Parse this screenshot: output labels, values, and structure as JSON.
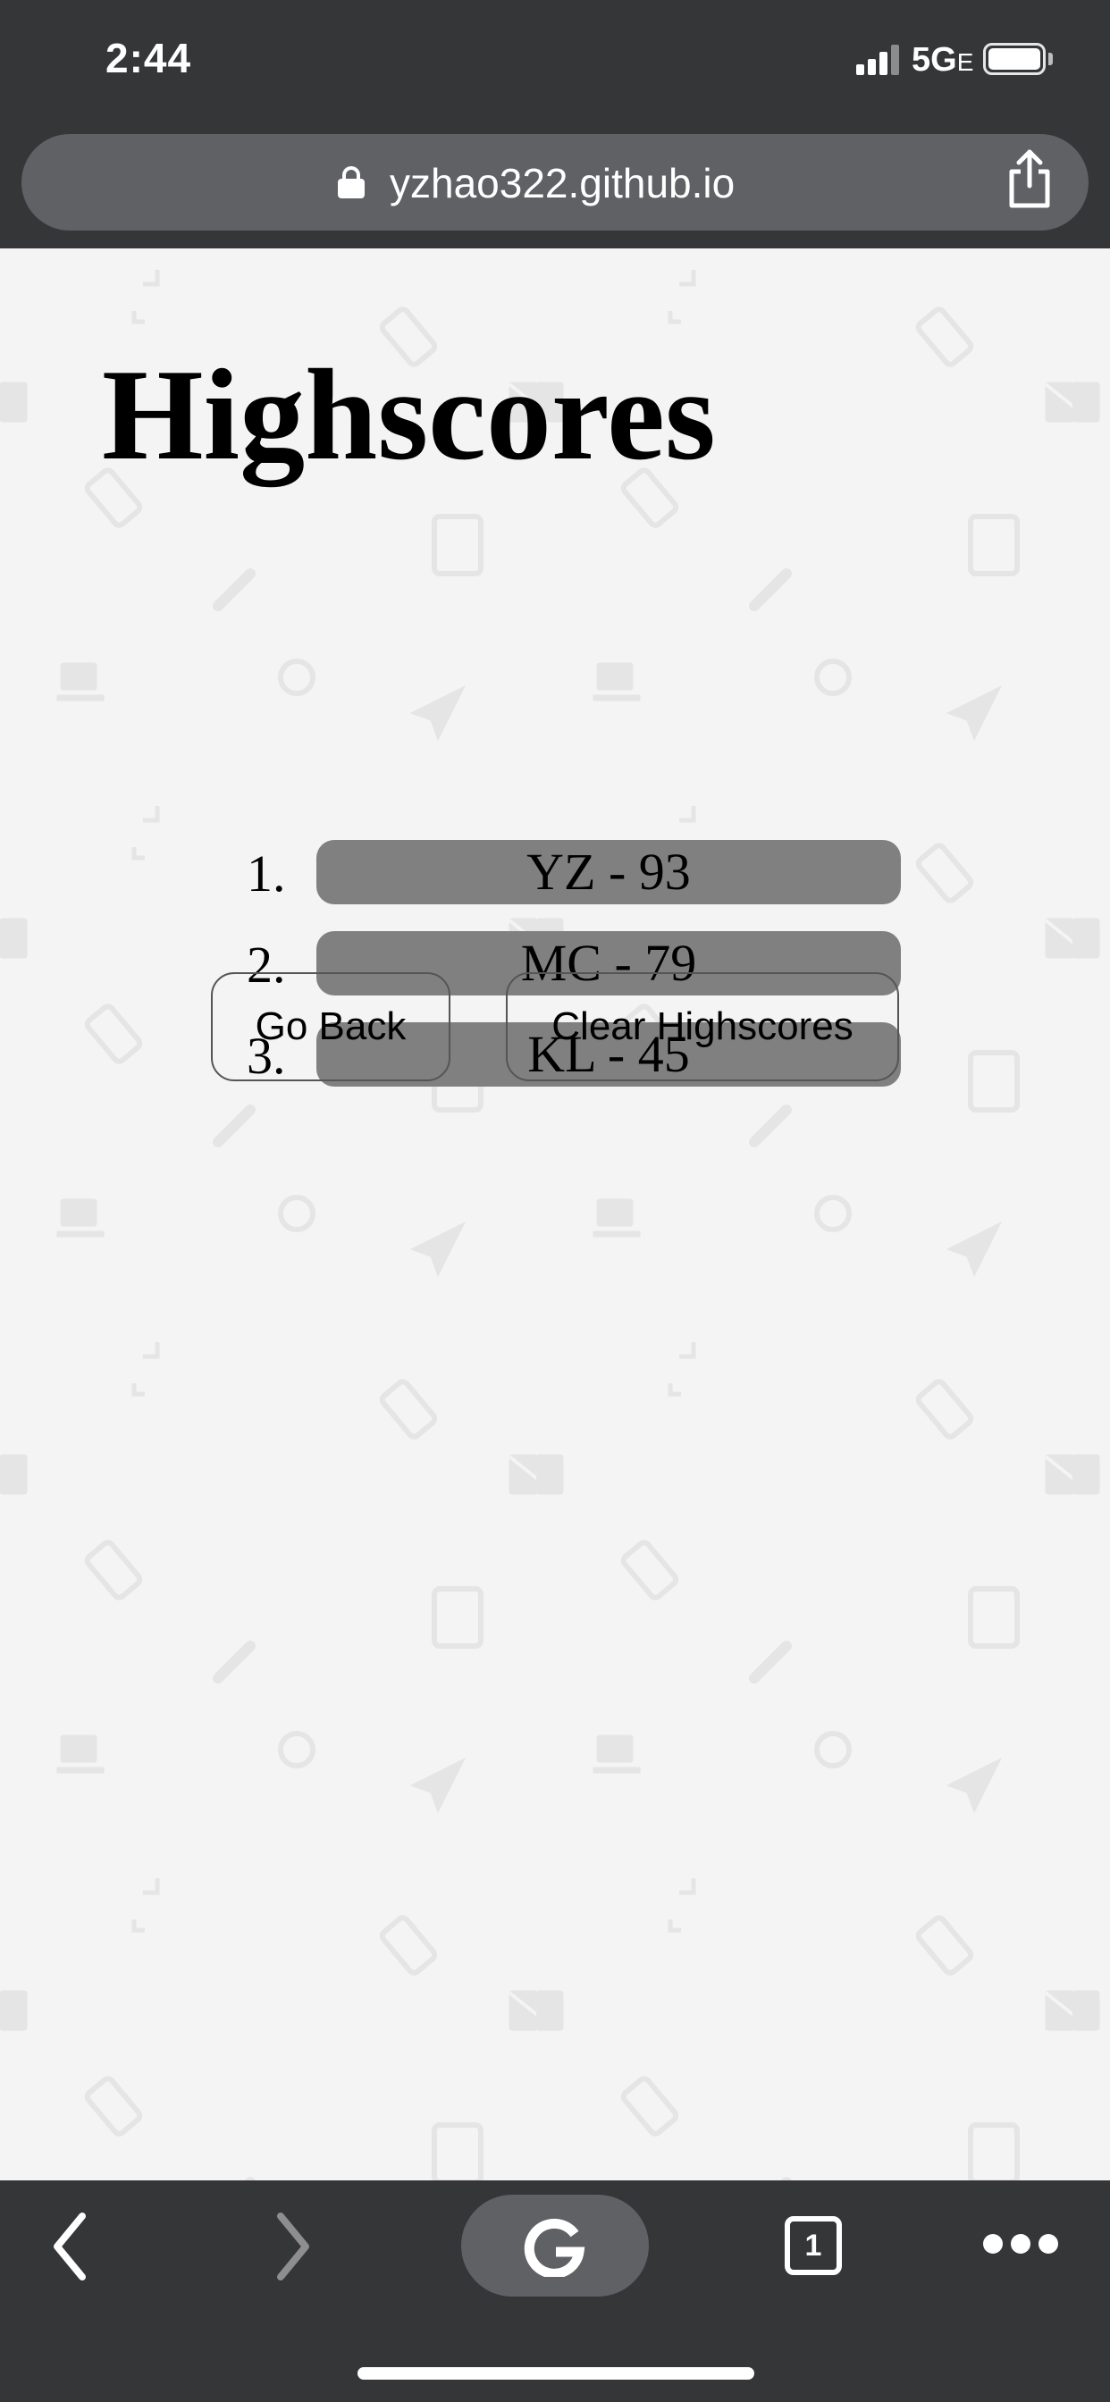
{
  "status_bar": {
    "time": "2:44",
    "network": "5G",
    "network_suffix": "E",
    "battery_level": 1.0
  },
  "browser": {
    "url": "yzhao322.github.io",
    "tab_count": "1",
    "colors": {
      "chrome": "#353638",
      "url_bar": "#5f6165"
    }
  },
  "page": {
    "title": "Highscores",
    "scores": [
      {
        "rank": "1.",
        "entry": "YZ - 93"
      },
      {
        "rank": "2.",
        "entry": "MC - 79"
      },
      {
        "rank": "3.",
        "entry": "KL - 45"
      }
    ],
    "buttons": {
      "back": "Go Back",
      "clear": "Clear Highscores"
    },
    "colors": {
      "background": "#f4f4f4",
      "score_pill": "#808080"
    }
  },
  "icons": {
    "toolbar": [
      "back-arrow-icon",
      "forward-arrow-icon",
      "google-icon",
      "tabs-icon",
      "more-icon"
    ],
    "background_pattern": [
      "mail-icon",
      "phone-icon",
      "tablet-icon",
      "pencil-icon",
      "coffee-icon",
      "paper-plane-icon",
      "watch-icon",
      "expand-icon"
    ]
  }
}
